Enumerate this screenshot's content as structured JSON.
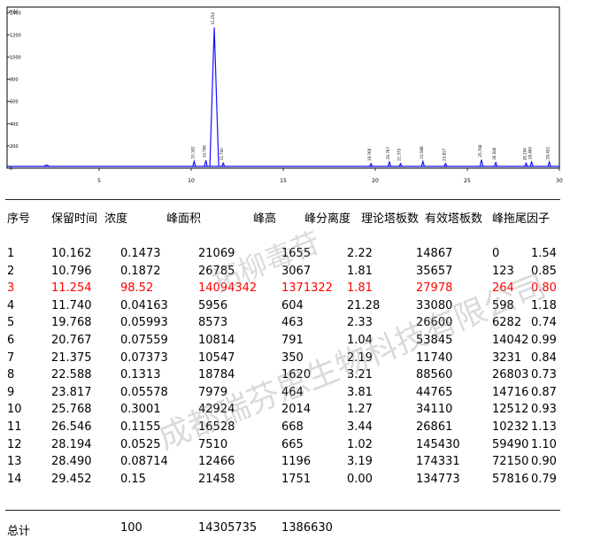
{
  "chart_data": {
    "type": "line",
    "y_unit": "mV",
    "y_ticks": [
      "1400",
      "1200",
      "1000",
      "800",
      "600",
      "400",
      "200",
      "0"
    ],
    "x_ticks": [
      "5",
      "10",
      "15",
      "20",
      "25",
      "30"
    ],
    "xlim": [
      0,
      30
    ],
    "ylim": [
      0,
      1450
    ],
    "peaks": [
      {
        "x": 10.162,
        "height": 45,
        "label": "10.162"
      },
      {
        "x": 10.796,
        "height": 55,
        "label": "10.796"
      },
      {
        "x": 11.254,
        "height": 1250,
        "label": "11.254"
      },
      {
        "x": 11.74,
        "height": 30,
        "label": "11.740"
      },
      {
        "x": 19.768,
        "height": 25,
        "label": "19.768"
      },
      {
        "x": 20.767,
        "height": 40,
        "label": "20.767"
      },
      {
        "x": 21.375,
        "height": 25,
        "label": "21.375"
      },
      {
        "x": 22.588,
        "height": 45,
        "label": "22.588"
      },
      {
        "x": 23.817,
        "height": 25,
        "label": "23.817"
      },
      {
        "x": 25.768,
        "height": 60,
        "label": "25.768"
      },
      {
        "x": 26.546,
        "height": 35,
        "label": "26.546"
      },
      {
        "x": 28.194,
        "height": 30,
        "label": "28.194"
      },
      {
        "x": 28.49,
        "height": 40,
        "label": "28.490"
      },
      {
        "x": 29.452,
        "height": 40,
        "label": "29.452"
      }
    ]
  },
  "table": {
    "headers": [
      "序号",
      "保留时间",
      "浓度",
      "峰面积",
      "峰高",
      "峰分离度",
      "理论塔板数",
      "有效塔板数",
      "峰拖尾因子"
    ],
    "rows": [
      [
        "1",
        "10.162",
        "0.1473",
        "21069",
        "1655",
        "2.22",
        "14867",
        "0",
        "1.54"
      ],
      [
        "2",
        "10.796",
        "0.1872",
        "26785",
        "3067",
        "1.81",
        "35657",
        "123",
        "0.85"
      ],
      [
        "3",
        "11.254",
        "98.52",
        "14094342",
        "1371322",
        "1.81",
        "27978",
        "264",
        "0.80"
      ],
      [
        "4",
        "11.740",
        "0.04163",
        "5956",
        "604",
        "21.28",
        "33080",
        "598",
        "1.18"
      ],
      [
        "5",
        "19.768",
        "0.05993",
        "8573",
        "463",
        "2.33",
        "26600",
        "6282",
        "0.74"
      ],
      [
        "6",
        "20.767",
        "0.07559",
        "10814",
        "791",
        "1.04",
        "53845",
        "14042",
        "0.99"
      ],
      [
        "7",
        "21.375",
        "0.07373",
        "10547",
        "350",
        "2.19",
        "11740",
        "3231",
        "0.84"
      ],
      [
        "8",
        "22.588",
        "0.1313",
        "18784",
        "1620",
        "3.21",
        "88560",
        "26803",
        "0.73"
      ],
      [
        "9",
        "23.817",
        "0.05578",
        "7979",
        "464",
        "3.81",
        "44765",
        "14716",
        "0.87"
      ],
      [
        "10",
        "25.768",
        "0.3001",
        "42924",
        "2014",
        "1.27",
        "34110",
        "12512",
        "0.93"
      ],
      [
        "11",
        "26.546",
        "0.1155",
        "16528",
        "668",
        "3.44",
        "26861",
        "10232",
        "1.13"
      ],
      [
        "12",
        "28.194",
        "0.0525",
        "7510",
        "665",
        "1.02",
        "145430",
        "59490",
        "1.10"
      ],
      [
        "13",
        "28.490",
        "0.08714",
        "12466",
        "1196",
        "3.19",
        "174331",
        "72150",
        "0.90"
      ],
      [
        "14",
        "29.452",
        "0.15",
        "21458",
        "1751",
        "0.00",
        "134773",
        "57816",
        "0.79"
      ]
    ],
    "highlight_row_index": 2,
    "highlight_color": "#ff0000",
    "total_label": "总计",
    "total_concentration": "100",
    "total_area": "14305735",
    "total_height": "1386630"
  },
  "watermark": {
    "line1": "成都瑞芬思生物科技有限公司",
    "line2": "拓柳毒苷"
  }
}
